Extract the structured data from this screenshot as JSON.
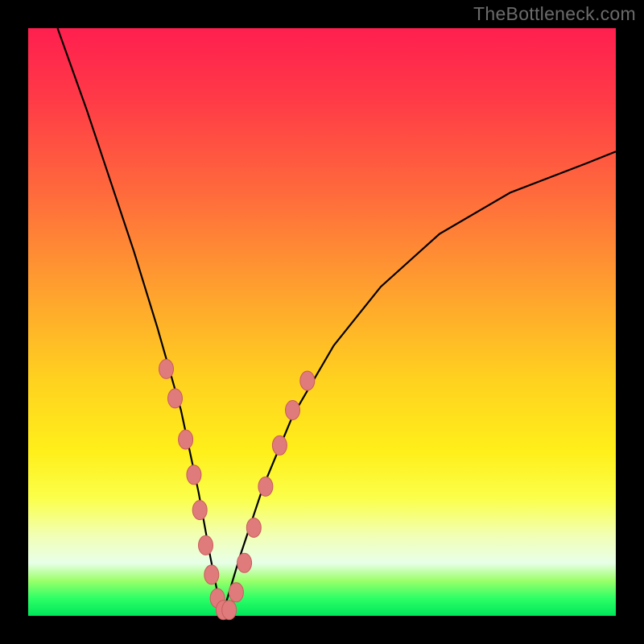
{
  "watermark": "TheBottleneck.com",
  "colors": {
    "gradient_top": "#ff1f4f",
    "gradient_bottom": "#00e65a",
    "curve": "#000000",
    "bead_fill": "#e07b7b",
    "bead_stroke": "#c95c5c",
    "frame": "#000000"
  },
  "chart_data": {
    "type": "line",
    "title": "",
    "xlabel": "",
    "ylabel": "",
    "xlim": [
      0,
      100
    ],
    "ylim": [
      0,
      100
    ],
    "grid": false,
    "legend": false,
    "note": "Two curves forming a V shape. Left curve drops steeply from top-left to a minimum near x≈33; right curve rises from the same minimum toward upper-right with decreasing slope. Background color encodes value (red=high, green=low). Salmon beads cluster along both curves near the valley.",
    "series": [
      {
        "name": "left-curve",
        "x": [
          5,
          10,
          14,
          18,
          22,
          26,
          29,
          31,
          33
        ],
        "values": [
          100,
          86,
          74,
          62,
          49,
          35,
          21,
          10,
          0
        ]
      },
      {
        "name": "right-curve",
        "x": [
          33,
          36,
          40,
          45,
          52,
          60,
          70,
          82,
          95,
          100
        ],
        "values": [
          0,
          10,
          22,
          34,
          46,
          56,
          65,
          72,
          77,
          79
        ]
      }
    ],
    "beads_left": [
      {
        "x": 23.5,
        "y": 42
      },
      {
        "x": 25.0,
        "y": 37
      },
      {
        "x": 26.8,
        "y": 30
      },
      {
        "x": 28.2,
        "y": 24
      },
      {
        "x": 29.2,
        "y": 18
      },
      {
        "x": 30.2,
        "y": 12
      },
      {
        "x": 31.2,
        "y": 7
      },
      {
        "x": 32.2,
        "y": 3
      },
      {
        "x": 33.2,
        "y": 1
      }
    ],
    "beads_right": [
      {
        "x": 34.2,
        "y": 1
      },
      {
        "x": 35.4,
        "y": 4
      },
      {
        "x": 36.8,
        "y": 9
      },
      {
        "x": 38.4,
        "y": 15
      },
      {
        "x": 40.4,
        "y": 22
      },
      {
        "x": 42.8,
        "y": 29
      },
      {
        "x": 45.0,
        "y": 35
      },
      {
        "x": 47.5,
        "y": 40
      }
    ]
  }
}
